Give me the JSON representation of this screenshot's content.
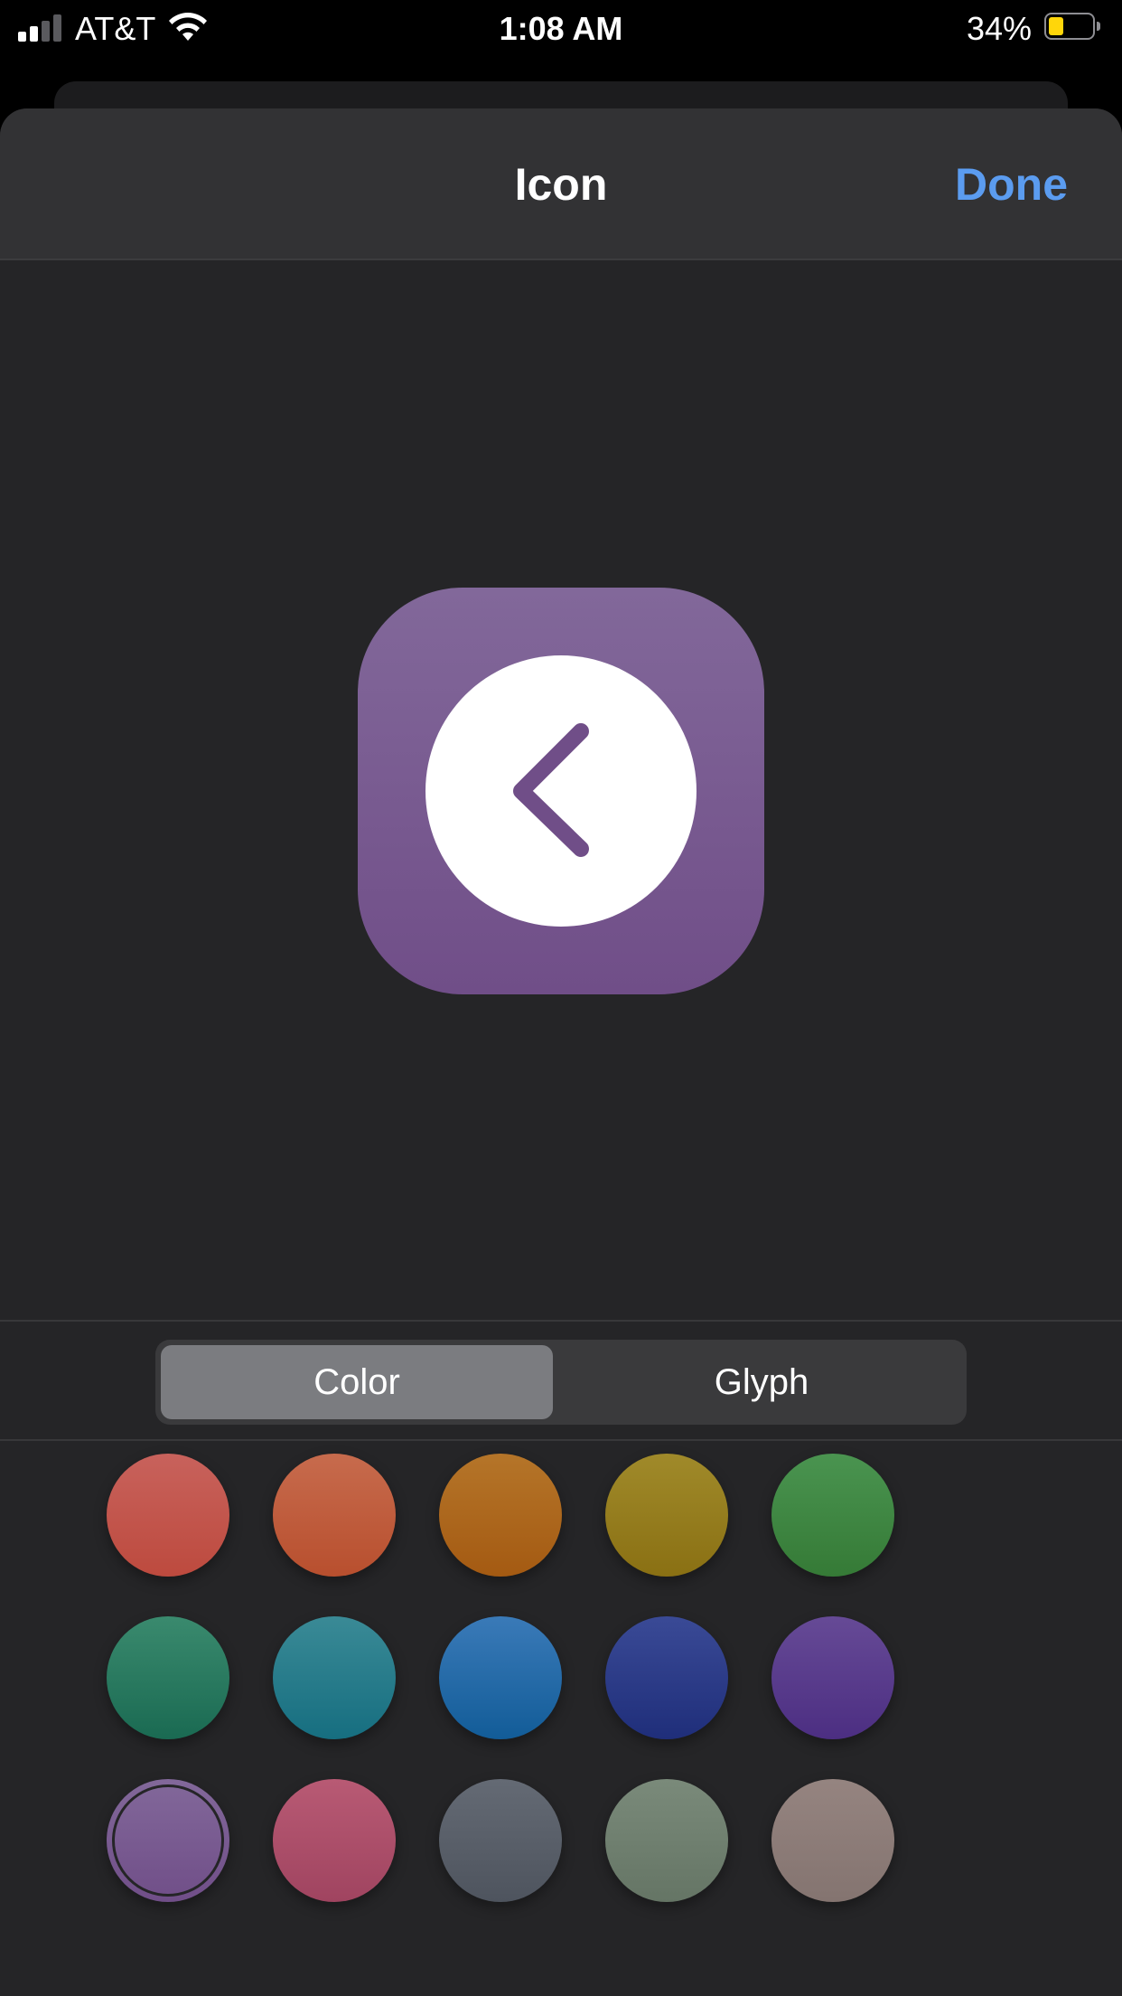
{
  "status_bar": {
    "carrier": "AT&T",
    "time": "1:08 AM",
    "battery_percent": "34%",
    "battery_level": 0.34,
    "icons": [
      "cellular-signal-icon",
      "wifi-icon",
      "battery-icon"
    ]
  },
  "nav": {
    "title": "Icon",
    "done_label": "Done",
    "accent_color": "#5b9cf0"
  },
  "preview": {
    "background_color": "#704e88",
    "glyph": "chevron-left-circle-icon"
  },
  "segmented_control": {
    "segments": [
      {
        "label": "Color",
        "selected": true
      },
      {
        "label": "Glyph",
        "selected": false
      }
    ]
  },
  "swatches": [
    {
      "name": "red",
      "top": "#c8625c",
      "bottom": "#bd4a3e",
      "selected": false
    },
    {
      "name": "orange",
      "top": "#c76b4d",
      "bottom": "#b84f2e",
      "selected": false
    },
    {
      "name": "amber",
      "top": "#b57529",
      "bottom": "#a45a12",
      "selected": false
    },
    {
      "name": "yellow",
      "top": "#a08a2a",
      "bottom": "#8a7013",
      "selected": false
    },
    {
      "name": "green",
      "top": "#4a9450",
      "bottom": "#357a36",
      "selected": false
    },
    {
      "name": "teal-green",
      "top": "#3a8a6e",
      "bottom": "#1a6a52",
      "selected": false
    },
    {
      "name": "teal",
      "top": "#3a8a96",
      "bottom": "#166e80",
      "selected": false
    },
    {
      "name": "blue",
      "top": "#3a7ab8",
      "bottom": "#125c98",
      "selected": false
    },
    {
      "name": "indigo",
      "top": "#3a4a96",
      "bottom": "#1f2e7a",
      "selected": false
    },
    {
      "name": "purple",
      "top": "#664a96",
      "bottom": "#4c2e82",
      "selected": false
    },
    {
      "name": "lavender",
      "top": "#82689a",
      "bottom": "#704e88",
      "selected": true
    },
    {
      "name": "pink",
      "top": "#b85a74",
      "bottom": "#a04460",
      "selected": false
    },
    {
      "name": "slate",
      "top": "#646a74",
      "bottom": "#4e545e",
      "selected": false
    },
    {
      "name": "sage",
      "top": "#7a8a7a",
      "bottom": "#657565",
      "selected": false
    },
    {
      "name": "taupe",
      "top": "#958480",
      "bottom": "#847470",
      "selected": false
    }
  ]
}
